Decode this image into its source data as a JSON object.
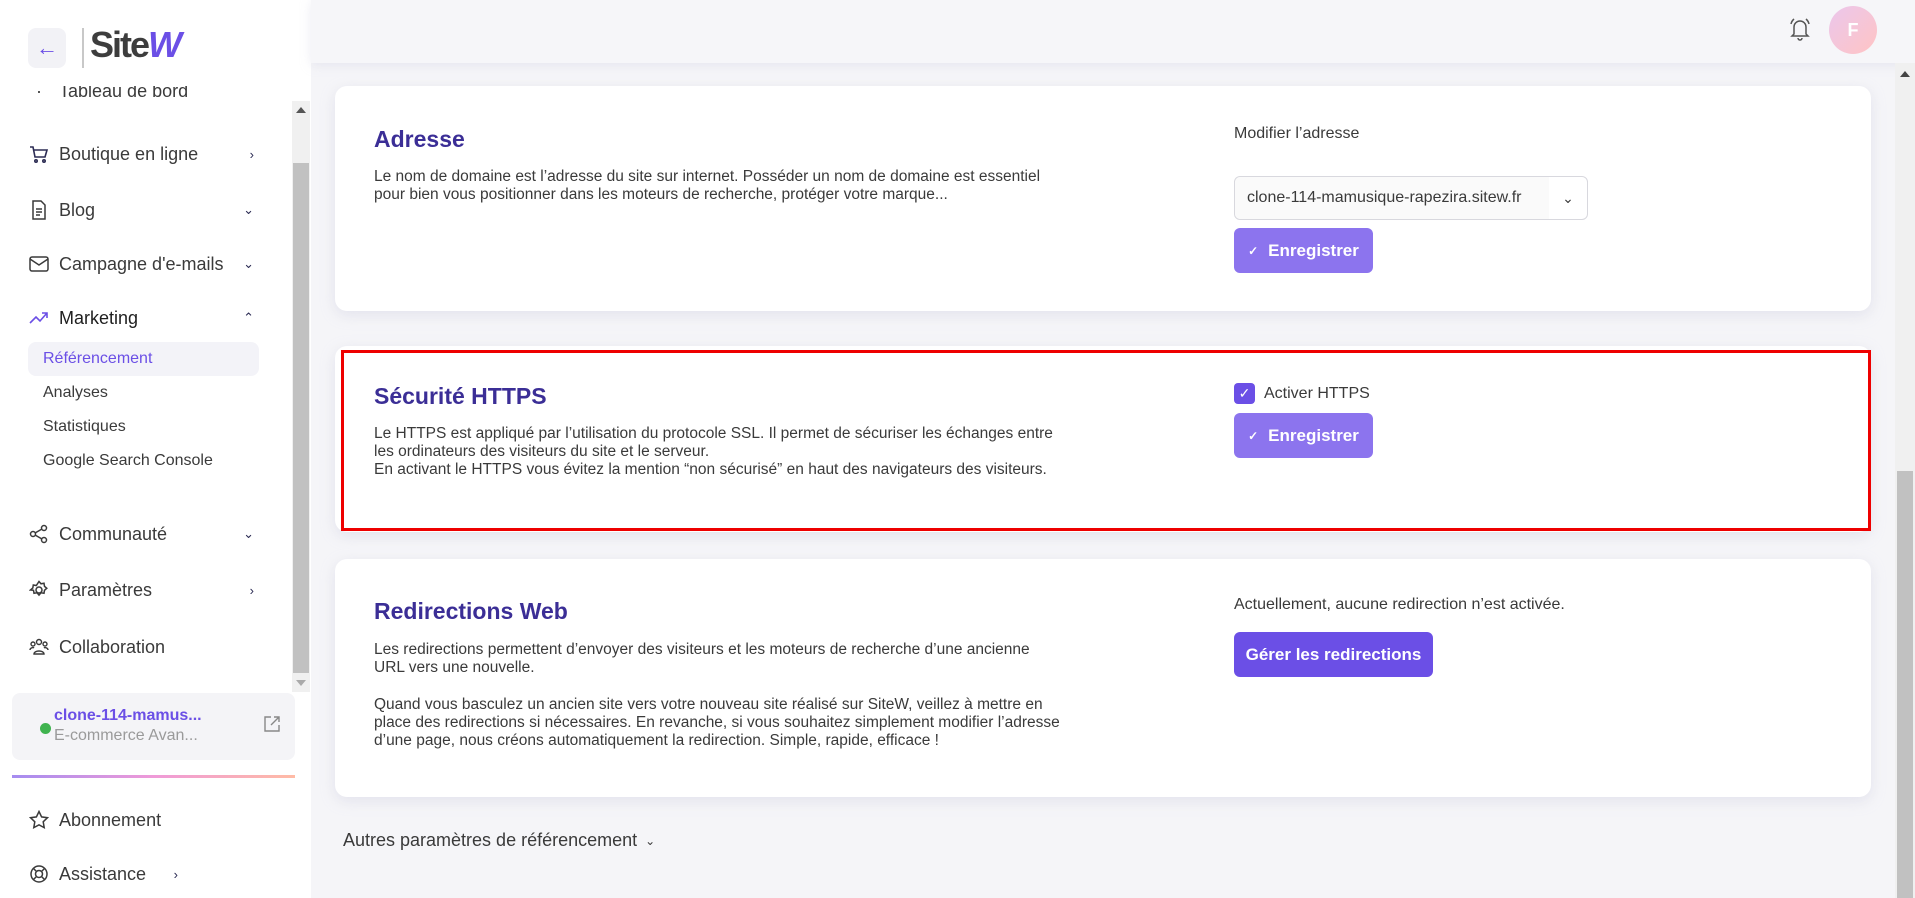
{
  "sidebar": {
    "back_icon": "arrow-left-icon",
    "logo": {
      "site": "Site",
      "w": "W"
    },
    "partial_item": "Tableau de bord",
    "items": [
      {
        "label": "Boutique en ligne",
        "icon": "cart-icon",
        "chevron": "›"
      },
      {
        "label": "Blog",
        "icon": "document-icon",
        "chevron": "⌄"
      },
      {
        "label": "Campagne d'e-mails",
        "icon": "mail-icon",
        "chevron": "⌄"
      },
      {
        "label": "Marketing",
        "icon": "trending-up-icon",
        "chevron": "⌃"
      },
      {
        "label": "Communauté",
        "icon": "share-icon",
        "chevron": "⌄"
      },
      {
        "label": "Paramètres",
        "icon": "gear-icon",
        "chevron": "›"
      },
      {
        "label": "Collaboration",
        "icon": "users-icon",
        "chevron": ""
      }
    ],
    "marketing_sub": [
      {
        "label": "Référencement",
        "selected": true
      },
      {
        "label": "Analyses"
      },
      {
        "label": "Statistiques"
      },
      {
        "label": "Google Search Console"
      }
    ],
    "site_card": {
      "name": "clone-114-mamus...",
      "plan": "E-commerce Avan...",
      "status_color": "#3fb34f"
    },
    "bottom": [
      {
        "label": "Abonnement",
        "icon": "star-icon",
        "chevron": ""
      },
      {
        "label": "Assistance",
        "icon": "lifebuoy-icon",
        "chevron": "›"
      }
    ]
  },
  "header": {
    "avatar_initial": "F"
  },
  "cards": {
    "adresse": {
      "title": "Adresse",
      "desc": "Le nom de domaine est l’adresse du site sur internet. Posséder un nom de domaine est essentiel\npour bien vous positionner dans les moteurs de recherche, protéger votre marque...",
      "modify_label": "Modifier l’adresse",
      "domain_value": "clone-114-mamusique-rapezira.sitew.fr",
      "save_label": "Enregistrer"
    },
    "https": {
      "title": "Sécurité HTTPS",
      "desc": "Le HTTPS est appliqué par l’utilisation du protocole SSL. Il permet de sécuriser les échanges entre\nles ordinateurs des visiteurs du site et le serveur.\nEn activant le HTTPS vous évitez la mention “non sécurisé” en haut des navigateurs des visiteurs.",
      "checkbox_label": "Activer HTTPS",
      "checked": true,
      "save_label": "Enregistrer"
    },
    "redirections": {
      "title": "Redirections Web",
      "desc1": "Les redirections permettent d’envoyer des visiteurs et les moteurs de recherche d’une ancienne\nURL vers une nouvelle.",
      "desc2": "Quand vous basculez un ancien site vers votre nouveau site réalisé sur SiteW, veillez à mettre en\nplace des redirections si nécessaires. En revanche, si vous souhaitez simplement modifier l’adresse\nd’une page, nous créons automatiquement la redirection. Simple, rapide, efficace !",
      "status": "Actuellement, aucune redirection n’est activée.",
      "button_label": "Gérer les redirections"
    }
  },
  "more_settings": "Autres paramètres de référencement",
  "colors": {
    "accent": "#6b4fe6",
    "title": "#3b2e96",
    "highlight": "#ee0000"
  }
}
